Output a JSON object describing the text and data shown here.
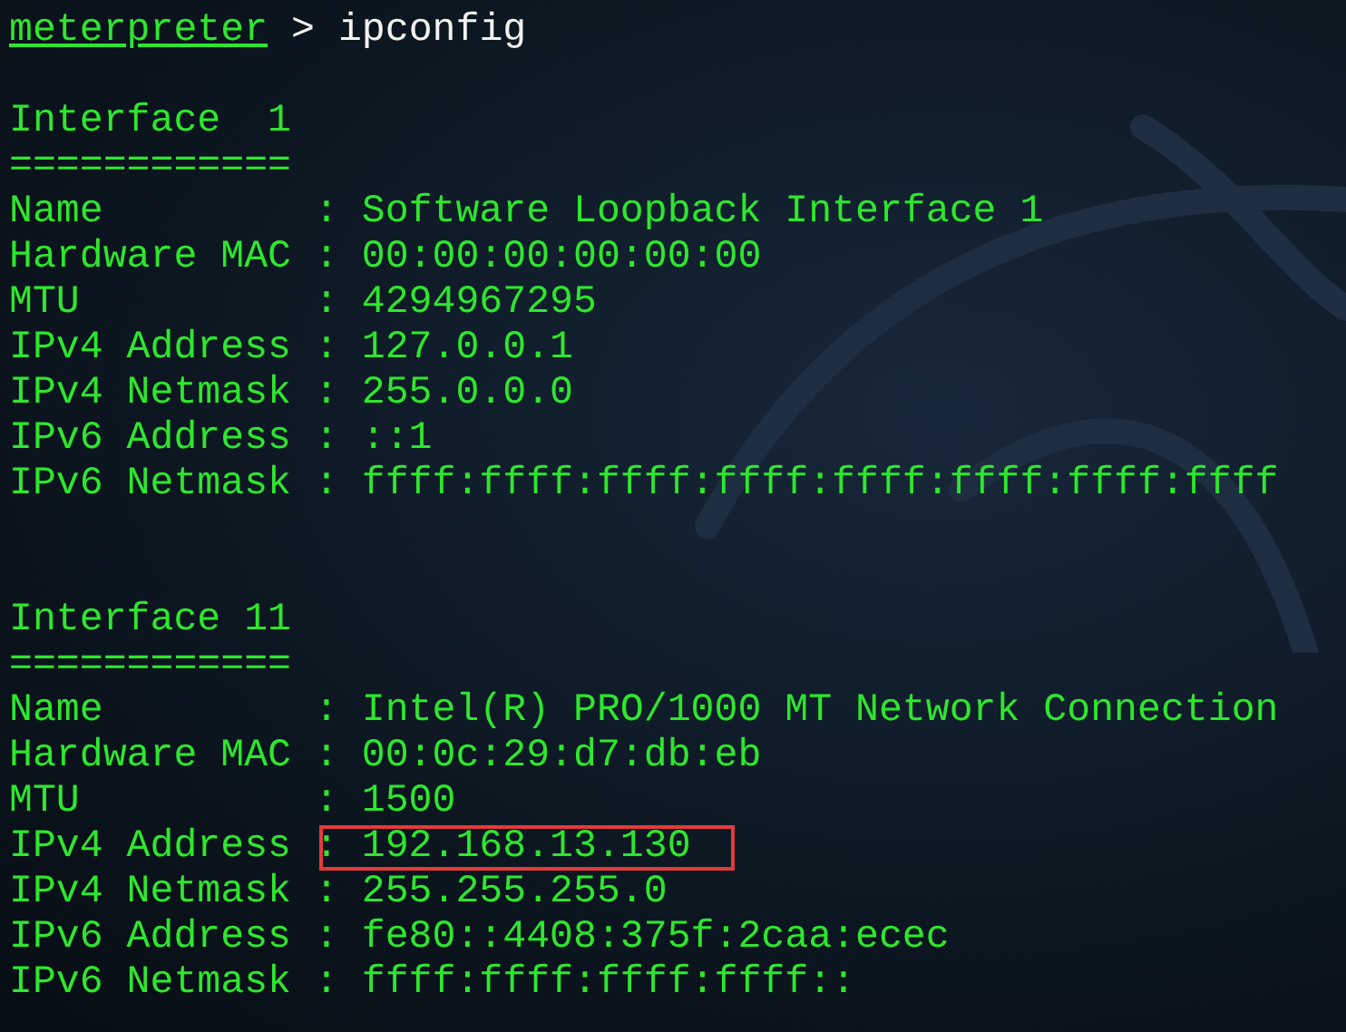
{
  "prompt": {
    "shell": "meterpreter",
    "separator": ">",
    "command": "ipconfig"
  },
  "interfaces": [
    {
      "title": "Interface  1",
      "rule": "============",
      "fields": [
        {
          "label": "Name",
          "separator": ":",
          "value": "Software Loopback Interface 1",
          "highlighted": false
        },
        {
          "label": "Hardware MAC",
          "separator": ":",
          "value": "00:00:00:00:00:00",
          "highlighted": false
        },
        {
          "label": "MTU",
          "separator": ":",
          "value": "4294967295",
          "highlighted": false
        },
        {
          "label": "IPv4 Address",
          "separator": ":",
          "value": "127.0.0.1",
          "highlighted": false
        },
        {
          "label": "IPv4 Netmask",
          "separator": ":",
          "value": "255.0.0.0",
          "highlighted": false
        },
        {
          "label": "IPv6 Address",
          "separator": ":",
          "value": "::1",
          "highlighted": false
        },
        {
          "label": "IPv6 Netmask",
          "separator": ":",
          "value": "ffff:ffff:ffff:ffff:ffff:ffff:ffff:ffff",
          "highlighted": false
        }
      ]
    },
    {
      "title": "Interface 11",
      "rule": "============",
      "fields": [
        {
          "label": "Name",
          "separator": ":",
          "value": "Intel(R) PRO/1000 MT Network Connection",
          "highlighted": false
        },
        {
          "label": "Hardware MAC",
          "separator": ":",
          "value": "00:0c:29:d7:db:eb",
          "highlighted": false
        },
        {
          "label": "MTU",
          "separator": ":",
          "value": "1500",
          "highlighted": false
        },
        {
          "label": "IPv4 Address",
          "separator": ":",
          "value": "192.168.13.130",
          "highlighted": true
        },
        {
          "label": "IPv4 Netmask",
          "separator": ":",
          "value": "255.255.255.0",
          "highlighted": false
        },
        {
          "label": "IPv6 Address",
          "separator": ":",
          "value": "fe80::4408:375f:2caa:ecec",
          "highlighted": false
        },
        {
          "label": "IPv6 Netmask",
          "separator": ":",
          "value": "ffff:ffff:ffff:ffff::",
          "highlighted": false
        }
      ]
    }
  ]
}
